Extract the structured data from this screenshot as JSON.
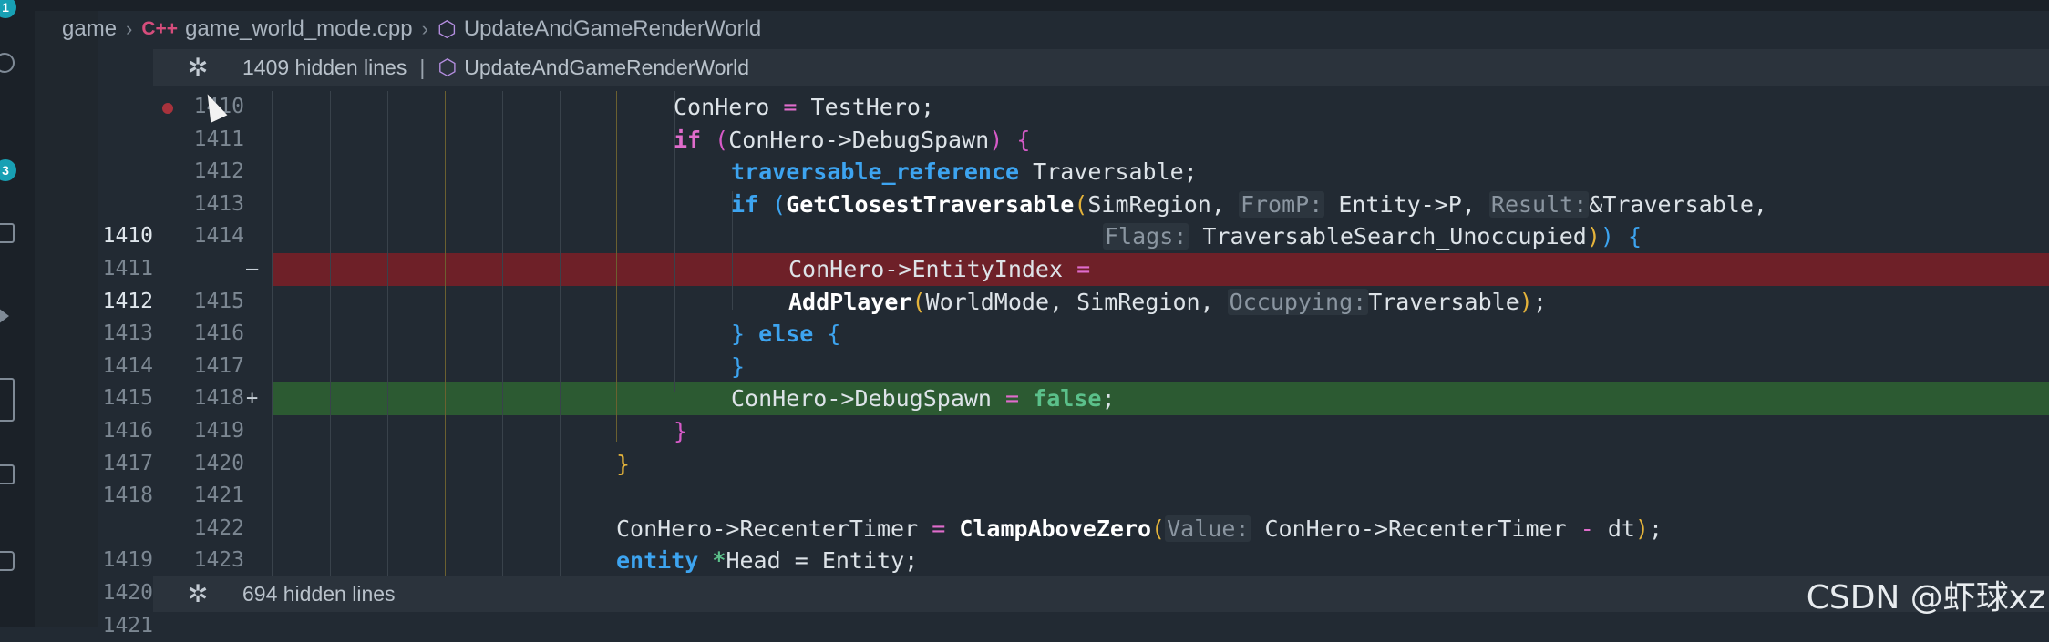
{
  "breadcrumb": {
    "folder": "game",
    "file_icon": "C++",
    "file": "game_world_mode.cpp",
    "symbol": "UpdateAndGameRenderWorld"
  },
  "fold_top": {
    "icon": "fold-icon",
    "text": "1409 hidden lines",
    "separator": "|",
    "symbol": "UpdateAndGameRenderWorld"
  },
  "fold_bottom": {
    "icon": "fold-icon",
    "text": "694 hidden lines"
  },
  "activity_badges": [
    "1",
    "3"
  ],
  "lines": [
    {
      "old": "",
      "new": "1410",
      "marker": "",
      "kind": "normal",
      "bp": true
    },
    {
      "old": "",
      "new": "1411",
      "marker": "",
      "kind": "normal"
    },
    {
      "old": "",
      "new": "1412",
      "marker": "",
      "kind": "normal"
    },
    {
      "old": "",
      "new": "1413",
      "marker": "",
      "kind": "normal"
    },
    {
      "old": "1410",
      "new": "1414",
      "marker": "",
      "kind": "normal",
      "cur": true
    },
    {
      "old": "1411",
      "new": "",
      "marker": "—",
      "kind": "del"
    },
    {
      "old": "1412",
      "new": "1415",
      "marker": "",
      "kind": "normal",
      "cur": true
    },
    {
      "old": "1413",
      "new": "1416",
      "marker": "",
      "kind": "normal"
    },
    {
      "old": "1414",
      "new": "1417",
      "marker": "",
      "kind": "normal"
    },
    {
      "old": "1415",
      "new": "1418",
      "marker": "+",
      "kind": "add"
    },
    {
      "old": "1416",
      "new": "1419",
      "marker": "",
      "kind": "normal"
    },
    {
      "old": "1417",
      "new": "1420",
      "marker": "",
      "kind": "normal"
    },
    {
      "old": "1418",
      "new": "1421",
      "marker": "",
      "kind": "normal"
    },
    {
      "old": "",
      "new": "1422",
      "marker": "",
      "kind": "normal"
    },
    {
      "old": "1419",
      "new": "1423",
      "marker": "",
      "kind": "normal"
    },
    {
      "old": "1420",
      "new": "",
      "marker": "",
      "kind": "normal"
    },
    {
      "old": "1421",
      "new": "",
      "marker": "",
      "kind": "normal"
    }
  ],
  "code": {
    "l0": [
      "ConHero",
      "=",
      "TestHero;"
    ],
    "l1": [
      "if",
      "(",
      "ConHero->DebugSpawn",
      ")",
      "{"
    ],
    "l2": [
      "traversable_reference",
      "Traversable;"
    ],
    "l3": [
      "if",
      "(",
      "GetClosestTraversable",
      "(",
      "SimRegion,",
      "FromP:",
      "Entity->P,",
      "Result:",
      "&Traversable,"
    ],
    "l4": [
      "Flags:",
      "TraversableSearch_Unoccupied",
      ")",
      ")",
      "{"
    ],
    "l5": [
      "ConHero->EntityIndex",
      "="
    ],
    "l6": [
      "AddPlayer",
      "(",
      "WorldMode, SimRegion,",
      "Occupying:",
      "Traversable",
      ")",
      ";"
    ],
    "l7": [
      "}",
      "else",
      "{"
    ],
    "l8": [
      "}"
    ],
    "l9": [
      "ConHero->DebugSpawn",
      "=",
      "false",
      ";"
    ],
    "l10": [
      "}"
    ],
    "l11": [
      "}"
    ],
    "l13": [
      "ConHero->RecenterTimer",
      "=",
      "ClampAboveZero",
      "(",
      "Value:",
      "ConHero->RecenterTimer",
      "-",
      "dt",
      ")",
      ";"
    ],
    "l14": [
      "entity",
      "*",
      "Head",
      "= Entity;"
    ]
  },
  "watermark": "CSDN @虾球xz",
  "colors": {
    "deleted": "#6e2028",
    "added": "#2c5a32",
    "keyword": "#3da4f0"
  }
}
